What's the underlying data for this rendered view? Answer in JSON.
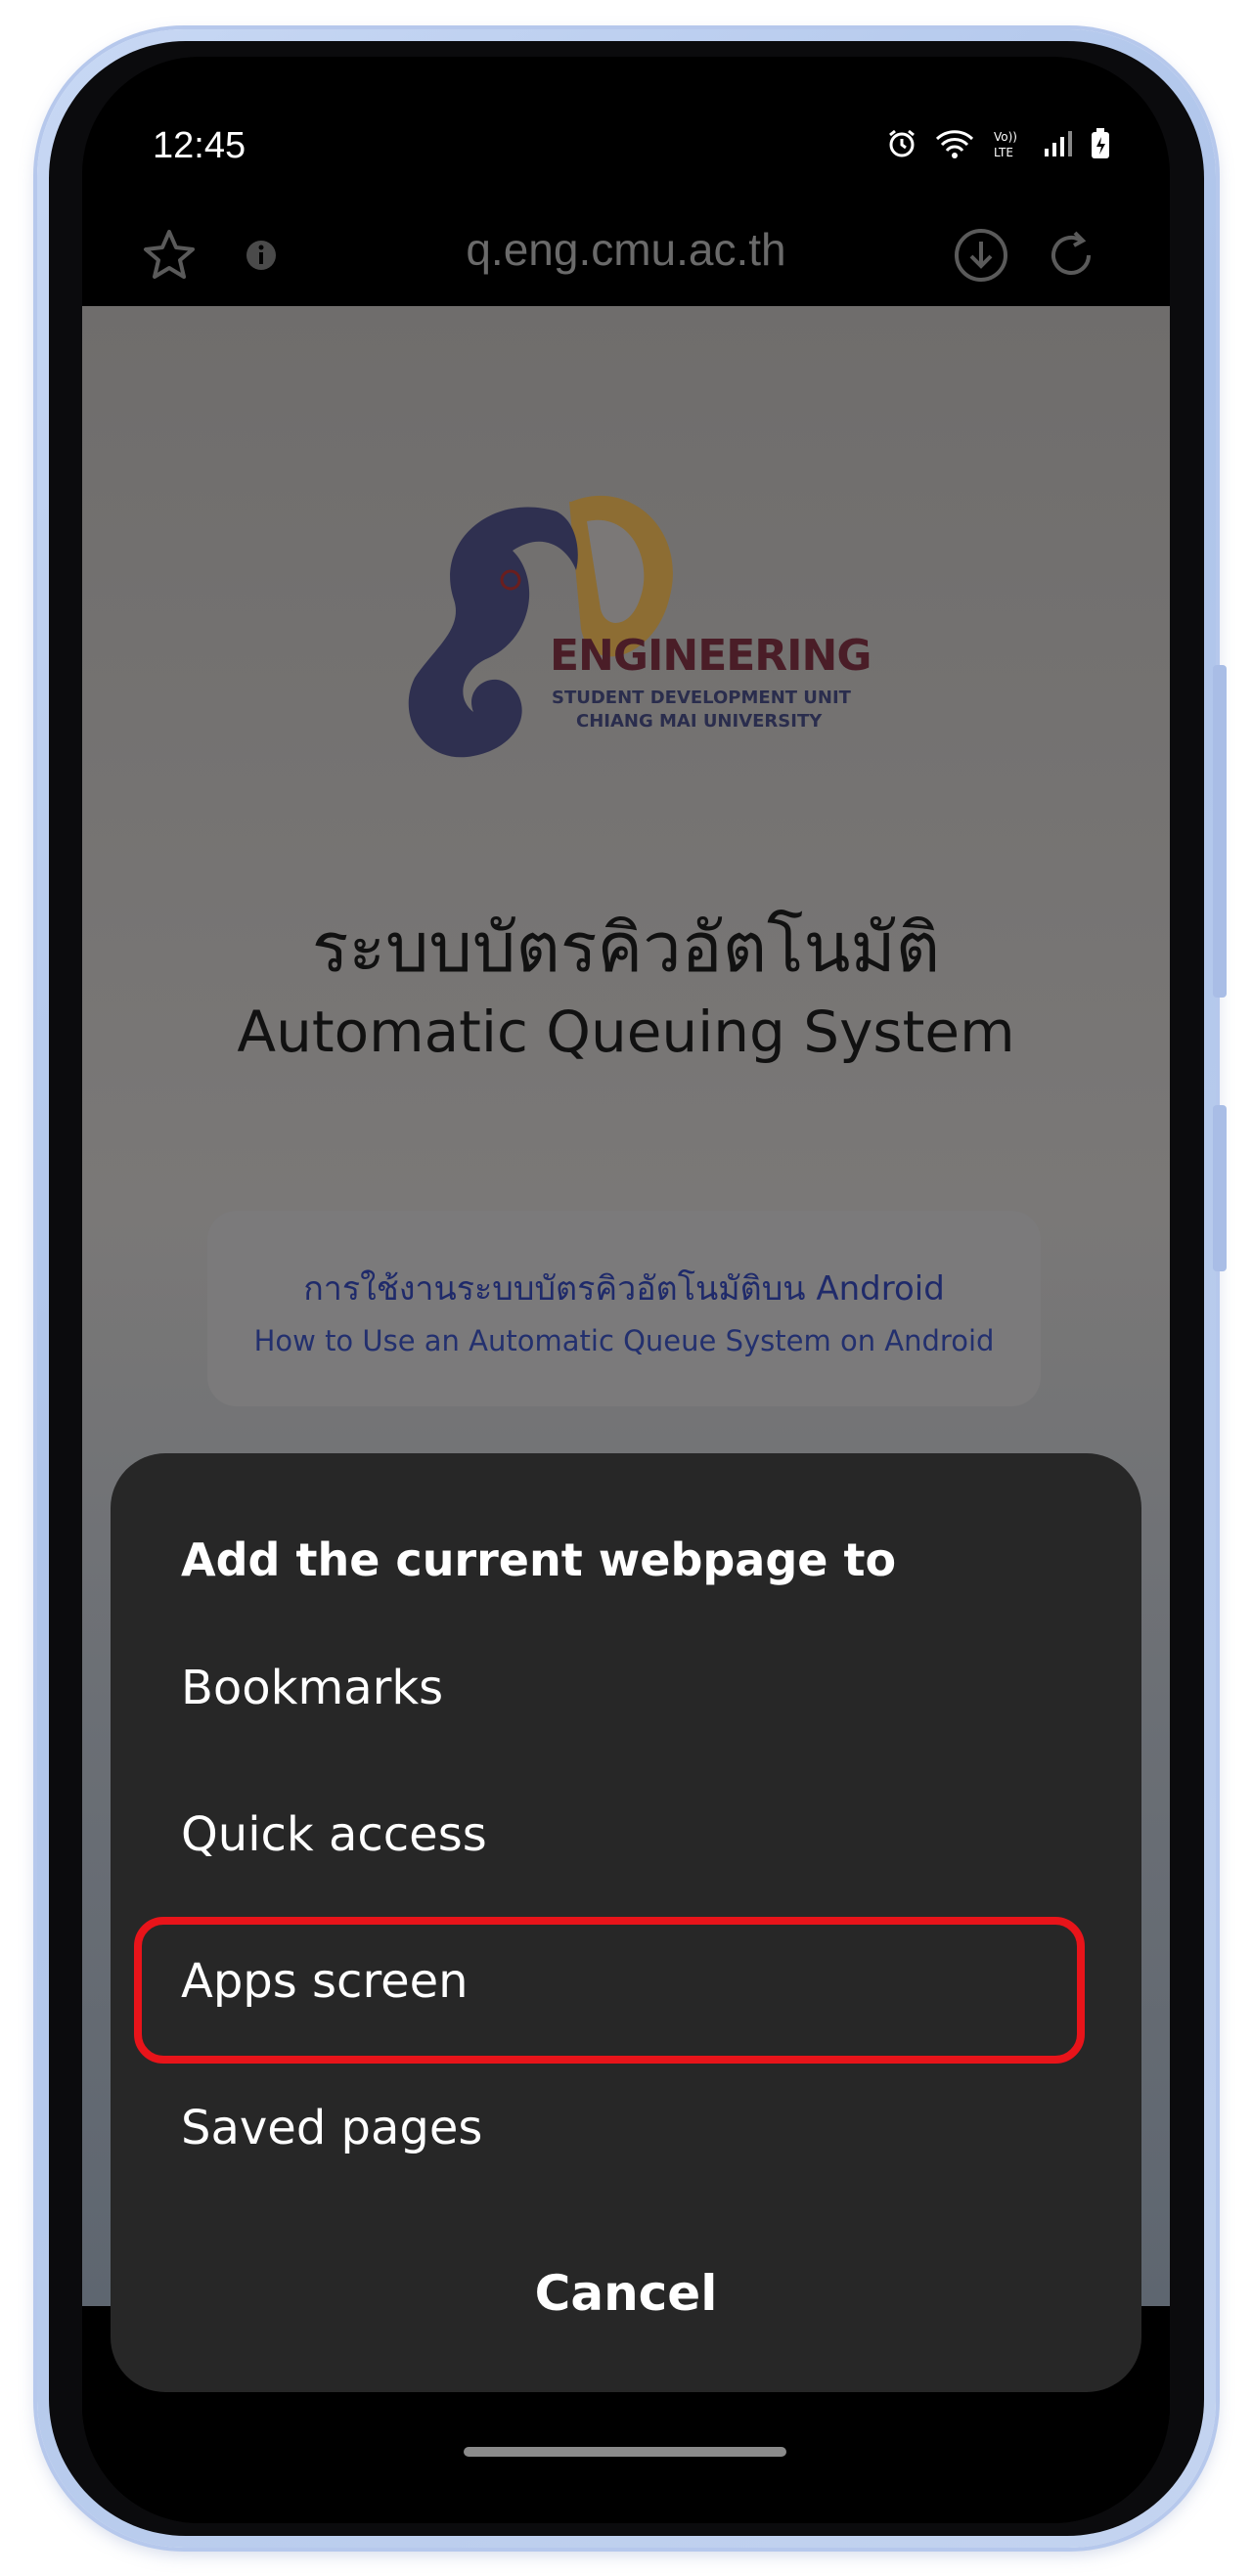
{
  "status_bar": {
    "time": "12:45",
    "icons": [
      "alarm-icon",
      "wifi-icon",
      "volte-icon",
      "signal-icon",
      "battery-icon"
    ]
  },
  "browser": {
    "url": "q.eng.cmu.ac.th",
    "left_icons": [
      "bookmark-star-icon",
      "site-info-icon"
    ],
    "right_icons": [
      "download-icon",
      "reload-icon"
    ]
  },
  "page": {
    "logo": {
      "line1": "ENGINEERING",
      "line2": "STUDENT DEVELOPMENT UNIT",
      "line3": "CHIANG MAI UNIVERSITY"
    },
    "title_th": "ระบบบัตรคิวอัตโนมัติ",
    "title_en": "Automatic Queuing System",
    "help_th": "การใช้งานระบบบัตรคิวอัตโนมัติบน Android",
    "help_en": "How to Use an Automatic Queue System on Android"
  },
  "dialog": {
    "title": "Add the current webpage to",
    "items": [
      "Bookmarks",
      "Quick access",
      "Apps screen",
      "Saved pages"
    ],
    "highlighted_item": "Apps screen",
    "cancel": "Cancel"
  },
  "colors": {
    "dialog_bg": "#272727",
    "highlight": "#e8141a",
    "frame": "#b6c8ec"
  }
}
